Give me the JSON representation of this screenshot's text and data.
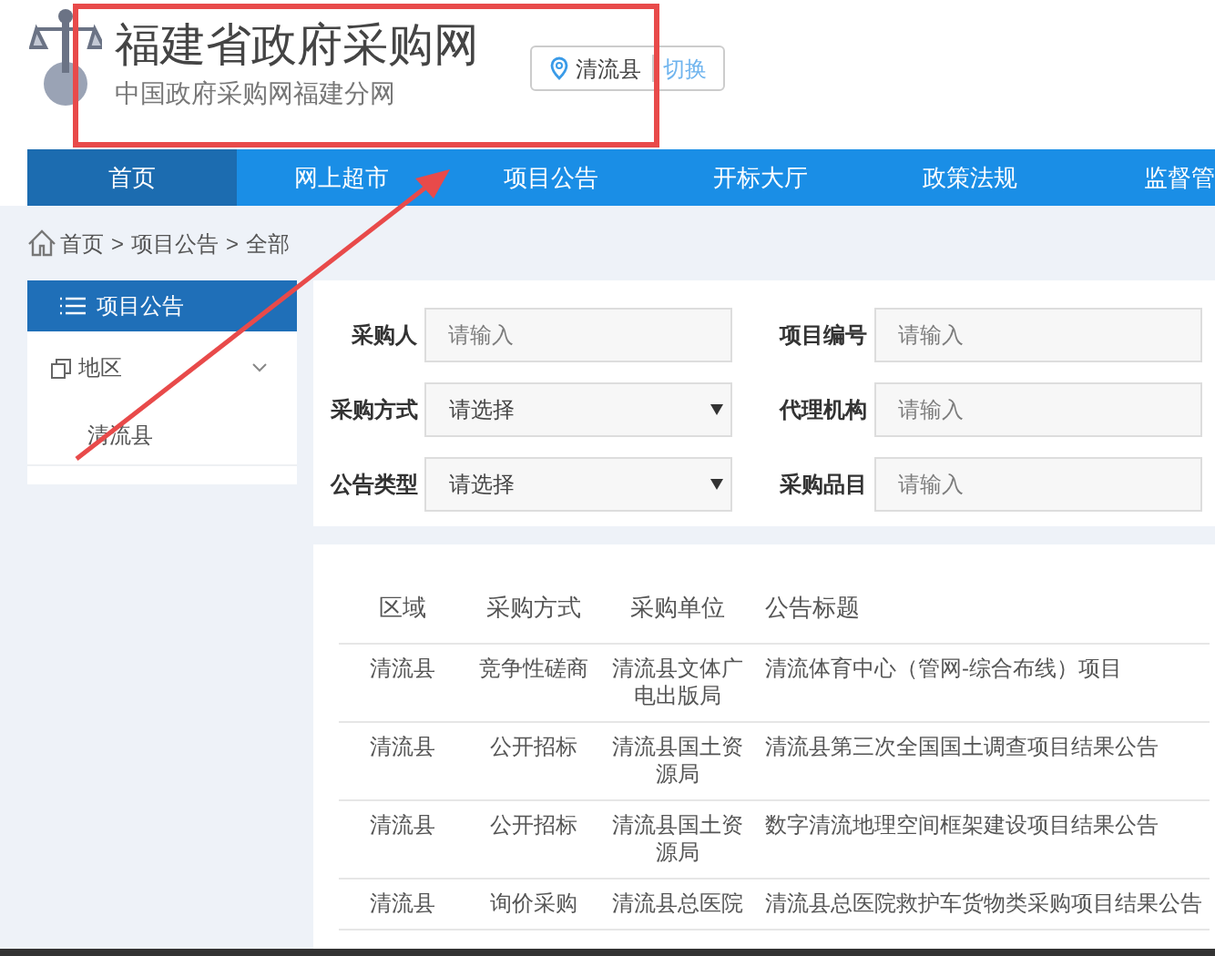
{
  "header": {
    "title": "福建省政府采购网",
    "subtitle": "中国政府采购网福建分网",
    "location": "清流县",
    "switch": "切换"
  },
  "nav": [
    {
      "label": "首页",
      "selected": true
    },
    {
      "label": "网上超市",
      "selected": false
    },
    {
      "label": "项目公告",
      "selected": false
    },
    {
      "label": "开标大厅",
      "selected": false
    },
    {
      "label": "政策法规",
      "selected": false
    },
    {
      "label": "监督管",
      "selected": false
    }
  ],
  "breadcrumb": [
    {
      "kind": "link",
      "label": "首页"
    },
    {
      "kind": "separator",
      "label": ">"
    },
    {
      "kind": "link",
      "label": "项目公告"
    },
    {
      "kind": "separator",
      "label": ">"
    },
    {
      "kind": "current",
      "label": "全部"
    }
  ],
  "sidebar": {
    "title": "项目公告",
    "group": {
      "label": "地区",
      "expanded": true,
      "children": [
        {
          "label": "清流县"
        }
      ]
    }
  },
  "filters": [
    {
      "label": "采购人",
      "kind": "input",
      "placeholder": "请输入"
    },
    {
      "label": "项目编号",
      "kind": "input",
      "placeholder": "请输入"
    },
    {
      "label": "采购方式",
      "kind": "select",
      "value": "请选择"
    },
    {
      "label": "代理机构",
      "kind": "input",
      "placeholder": "请输入"
    },
    {
      "label": "公告类型",
      "kind": "select",
      "value": "请选择"
    },
    {
      "label": "采购品目",
      "kind": "input",
      "placeholder": "请输入"
    }
  ],
  "table": {
    "columns": [
      "区域",
      "采购方式",
      "采购单位",
      "公告标题"
    ],
    "rows": [
      [
        "清流县",
        "竞争性磋商",
        "清流县文体广电出版局",
        "清流体育中心（管网-综合布线）项目"
      ],
      [
        "清流县",
        "公开招标",
        "清流县国土资源局",
        "清流县第三次全国国土调查项目结果公告"
      ],
      [
        "清流县",
        "公开招标",
        "清流县国土资源局",
        "数字清流地理空间框架建设项目结果公告"
      ],
      [
        "清流县",
        "询价采购",
        "清流县总医院",
        "清流县总医院救护车货物类采购项目结果公告"
      ]
    ]
  }
}
